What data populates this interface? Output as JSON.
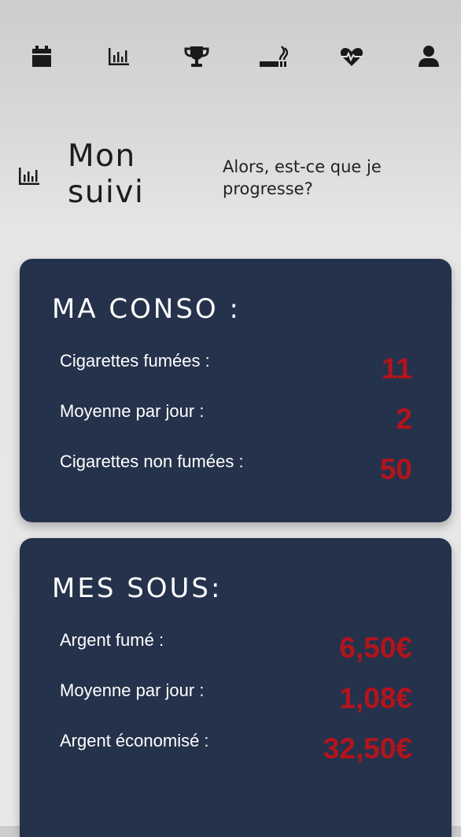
{
  "nav": {
    "items": [
      {
        "icon": "calendar-icon",
        "label": ""
      },
      {
        "icon": "bar-chart-icon",
        "label": ""
      },
      {
        "icon": "trophy-icon",
        "label": ""
      },
      {
        "icon": "cigarette-icon",
        "label": ""
      },
      {
        "icon": "heartbeat-icon",
        "label": ""
      },
      {
        "icon": "user-icon",
        "label": ""
      }
    ],
    "active_icon_color": "#1a1a1a"
  },
  "header": {
    "icon": "bar-chart-icon",
    "title": "Mon suivi",
    "subtitle": "Alors, est-ce que je progresse?"
  },
  "conso": {
    "title": "MA CONSO :",
    "rows": [
      {
        "label": "Cigarettes fumées :",
        "value": "11"
      },
      {
        "label": "Moyenne par jour :",
        "value": "2"
      },
      {
        "label": "Cigarettes non fumées :",
        "value": "50"
      }
    ]
  },
  "sous": {
    "title": "MES SOUS:",
    "rows": [
      {
        "label": "Argent fumé :",
        "value": "6,50€"
      },
      {
        "label": "Moyenne par jour :",
        "value": "1,08€"
      },
      {
        "label": "Argent économisé :",
        "value": "32,50€"
      }
    ]
  },
  "colors": {
    "card_background": "#25324b",
    "value_red": "#b3141c",
    "text_white": "#ffffff"
  }
}
